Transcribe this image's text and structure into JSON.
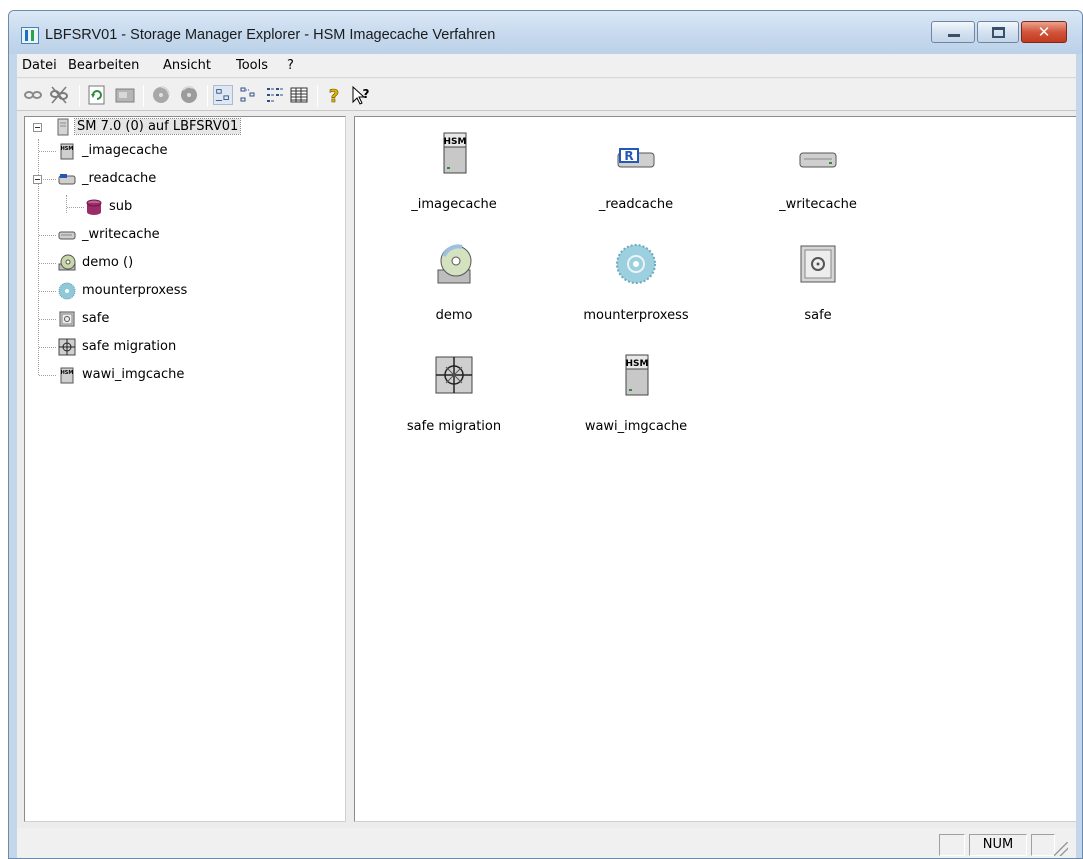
{
  "window": {
    "title": "LBFSRV01 - Storage Manager Explorer  -  HSM Imagecache Verfahren",
    "close_glyph": "✕"
  },
  "menu": [
    "Datei",
    "Bearbeiten",
    "Ansicht",
    "Tools",
    "?"
  ],
  "toolbar": {
    "buttons": [
      "connect-icon",
      "disconnect-icon",
      "refresh-icon",
      "properties-icon",
      "mount-icon",
      "unmount-icon",
      "large-icons-view-icon",
      "small-icons-view-icon",
      "list-view-icon",
      "details-view-icon",
      "help-icon",
      "context-help-icon"
    ]
  },
  "tree": {
    "root": "SM 7.0 (0) auf LBFSRV01",
    "items": [
      "_imagecache",
      "_readcache",
      "sub",
      "_writecache",
      "demo ()",
      "mounterproxess",
      "safe",
      "safe migration",
      "wawi_imgcache"
    ]
  },
  "icons": [
    "_imagecache",
    "_readcache",
    "_writecache",
    "demo",
    "mounterproxess",
    "safe",
    "safe migration",
    "wawi_imgcache"
  ],
  "status": {
    "num": "NUM"
  },
  "colors": {
    "titlebar": "#c6d9ee",
    "close_button": "#d2553b",
    "selection": "#e6e6e6"
  }
}
